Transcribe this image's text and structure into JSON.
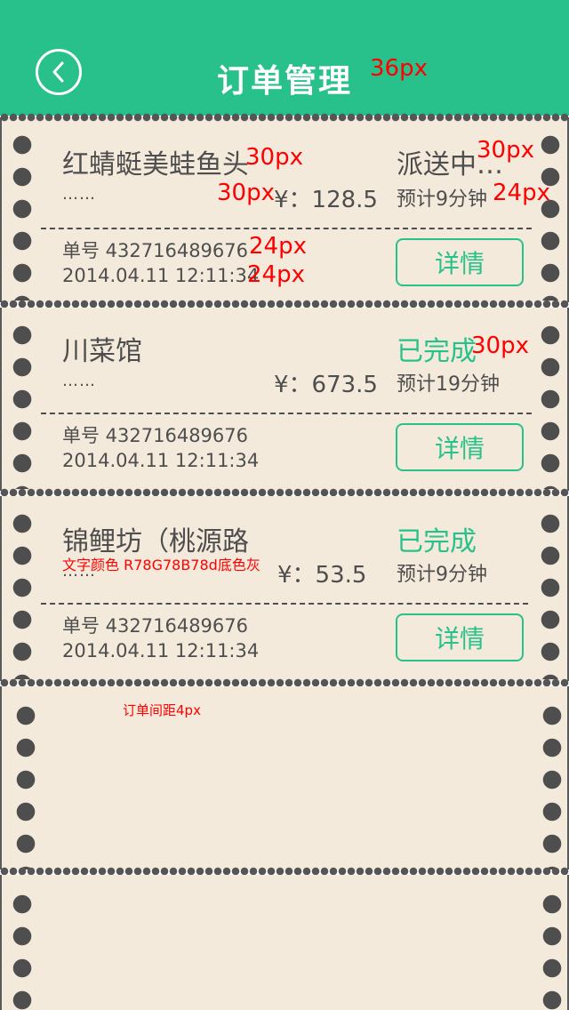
{
  "header": {
    "title": "订单管理",
    "title_annotation": "36px",
    "back_icon": "chevron-left-icon",
    "background_color": "#28c18b"
  },
  "orders": [
    {
      "shop_name": "红蜻蜓美蛙鱼头",
      "dots": "……",
      "price": "¥：128.5",
      "status": "派送中…",
      "eta": "预计9分钟",
      "order_no": "单号 432716489676",
      "datetime": "2014.04.11  12:11:34",
      "detail_label": "详情"
    },
    {
      "shop_name": "川菜馆",
      "dots": "……",
      "price": "¥：673.5",
      "status": "已完成",
      "eta": "预计19分钟",
      "order_no": "单号 432716489676",
      "datetime": "2014.04.11  12:11:34",
      "detail_label": "详情"
    },
    {
      "shop_name": "锦鲤坊（桃源路",
      "dots": "……",
      "price": "¥：53.5",
      "status": "已完成",
      "eta": "预计9分钟",
      "order_no": "单号 432716489676",
      "datetime": "2014.04.11  12:11:34",
      "detail_label": "详情"
    }
  ],
  "annotations": {
    "shop_name_size": "30px",
    "price_size": "30px",
    "status_size": "30px",
    "eta_size": "24px",
    "order_no_size": "24px",
    "datetime_size": "24px",
    "status_done_size": "30px",
    "text_color_note": "文字颜色 R78G78B78d底色灰",
    "order_gap_note": "订单间距4px"
  },
  "colors": {
    "accent": "#28c18b",
    "text": "#4e4e4e",
    "card_background": "#f3eadc",
    "annotation": "#ff0000"
  }
}
